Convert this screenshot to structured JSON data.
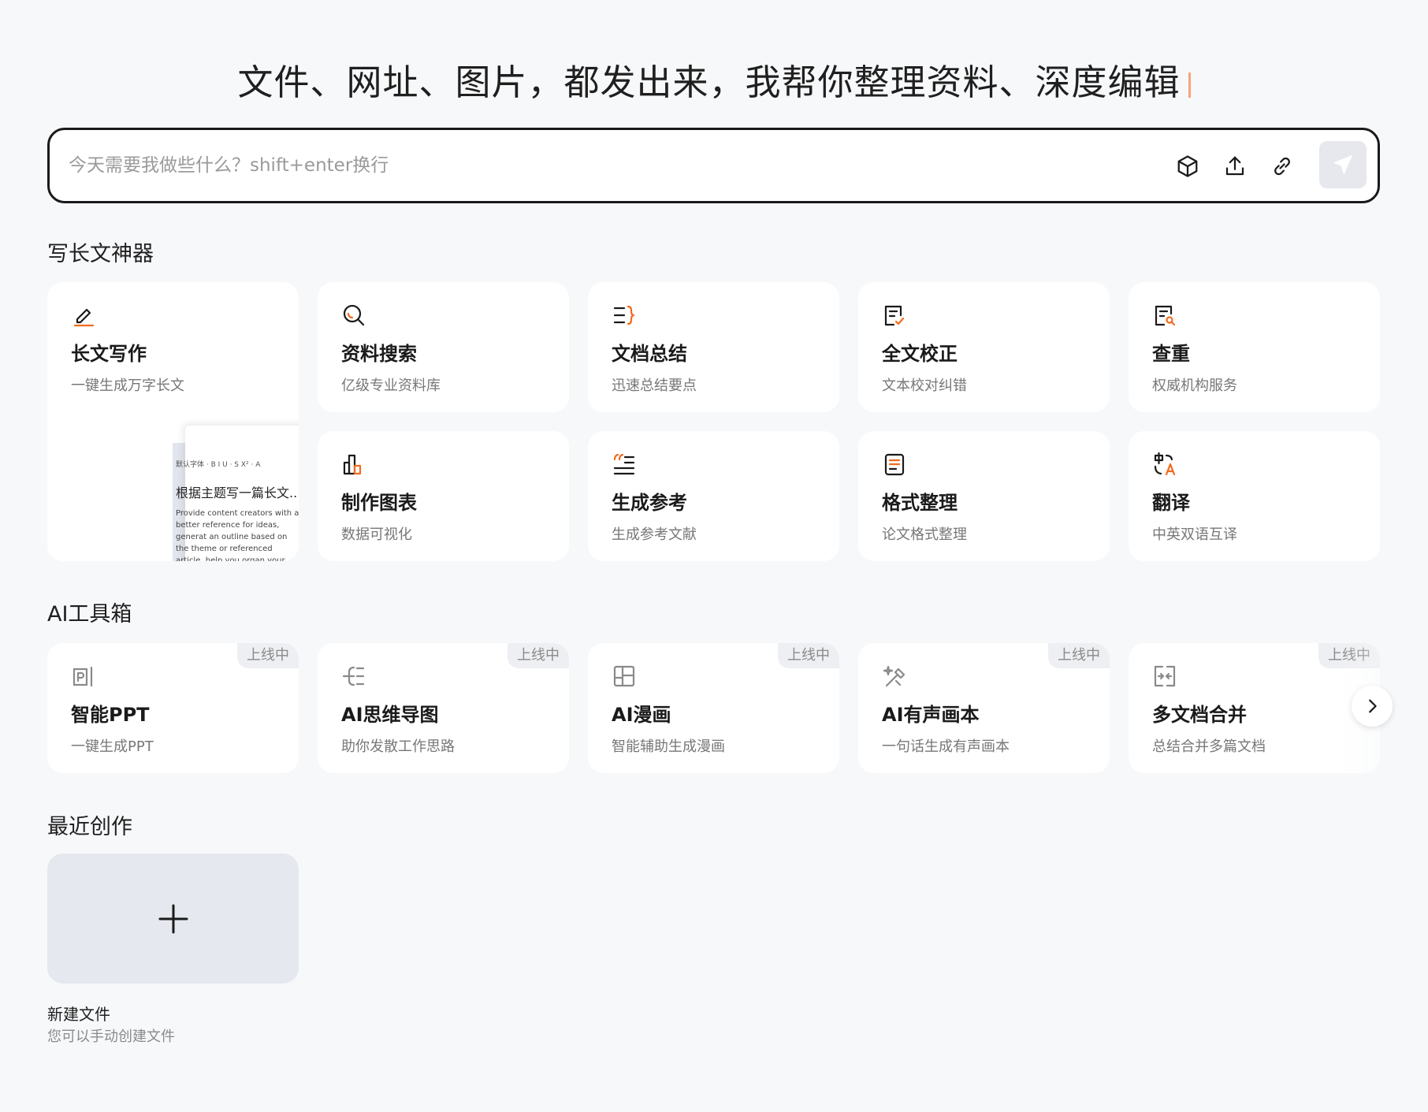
{
  "headline": "文件、网址、图片，都发出来，我帮你整理资料、深度编辑",
  "search": {
    "placeholder": "今天需要我做些什么？shift+enter换行",
    "value": ""
  },
  "colors": {
    "accent": "#f26b1d",
    "dark": "#1a1a1a",
    "muted": "#777777"
  },
  "sections": {
    "writing": "写长文神器",
    "ai_tools": "AI工具箱",
    "recent": "最近创作"
  },
  "writing_cards": [
    {
      "title": "长文写作",
      "desc": "一键生成万字长文",
      "icon": "pen-icon"
    },
    {
      "title": "资料搜索",
      "desc": "亿级专业资料库",
      "icon": "search-icon"
    },
    {
      "title": "文档总结",
      "desc": "迅速总结要点",
      "icon": "summary-icon"
    },
    {
      "title": "全文校正",
      "desc": "文本校对纠错",
      "icon": "proofread-icon"
    },
    {
      "title": "查重",
      "desc": "权威机构服务",
      "icon": "plagiarism-check-icon"
    },
    {
      "title": "制作图表",
      "desc": "数据可视化",
      "icon": "chart-icon"
    },
    {
      "title": "生成参考",
      "desc": "生成参考文献",
      "icon": "quote-icon"
    },
    {
      "title": "格式整理",
      "desc": "论文格式整理",
      "icon": "format-icon"
    },
    {
      "title": "翻译",
      "desc": "中英双语互译",
      "icon": "translate-icon"
    }
  ],
  "preview": {
    "toolbar": "默认字体 · B I U · S X² · A",
    "title": "根据主题写一篇长文..",
    "text": "Provide content creators with a better reference for ideas, generat an outline based on the theme or referenced article, help you organ your thoughts, and generate a"
  },
  "ai_tools": [
    {
      "title": "智能PPT",
      "desc": "一键生成PPT",
      "tag": "上线中",
      "icon": "ppt-icon"
    },
    {
      "title": "AI思维导图",
      "desc": "助你发散工作思路",
      "tag": "上线中",
      "icon": "mindmap-icon"
    },
    {
      "title": "AI漫画",
      "desc": "智能辅助生成漫画",
      "tag": "上线中",
      "icon": "comic-icon"
    },
    {
      "title": "AI有声画本",
      "desc": "一句话生成有声画本",
      "tag": "上线中",
      "icon": "audio-book-icon"
    },
    {
      "title": "多文档合并",
      "desc": "总结合并多篇文档",
      "tag": "上线中",
      "icon": "merge-icon"
    }
  ],
  "recent": {
    "new_file_label": "新建文件",
    "new_file_desc": "您可以手动创建文件"
  }
}
